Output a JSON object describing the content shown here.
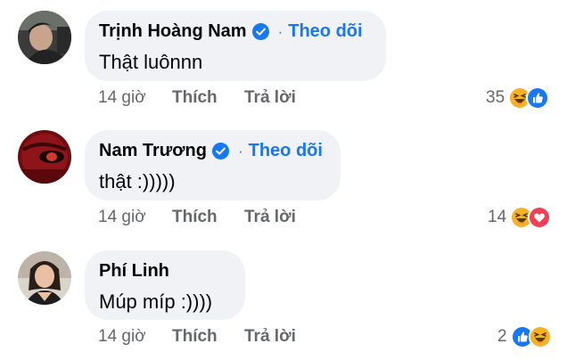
{
  "comments": [
    {
      "author": "Trịnh Hoàng Nam",
      "verified": true,
      "follow_label": "Theo dõi",
      "text": "Thật luônnn",
      "time": "14 giờ",
      "like_label": "Thích",
      "reply_label": "Trả lời",
      "reaction_count": "35",
      "reactions": [
        "haha-icon",
        "like-icon"
      ]
    },
    {
      "author": "Nam Trương",
      "verified": true,
      "follow_label": "Theo dõi",
      "text": "thật :)))))",
      "time": "14 giờ",
      "like_label": "Thích",
      "reply_label": "Trả lời",
      "reaction_count": "14",
      "reactions": [
        "haha-icon",
        "love-icon"
      ]
    },
    {
      "author": "Phí Linh",
      "verified": false,
      "text": "Múp míp :))))",
      "time": "14 giờ",
      "like_label": "Thích",
      "reply_label": "Trả lời",
      "reaction_count": "2",
      "reactions": [
        "like-icon",
        "haha-icon"
      ]
    }
  ],
  "colors": {
    "bubble": "#f0f2f5",
    "follow": "#1877f2",
    "secondary_text": "#65676b",
    "like": "#1877f2",
    "love": "#f33e58",
    "haha": "#f7b125"
  }
}
